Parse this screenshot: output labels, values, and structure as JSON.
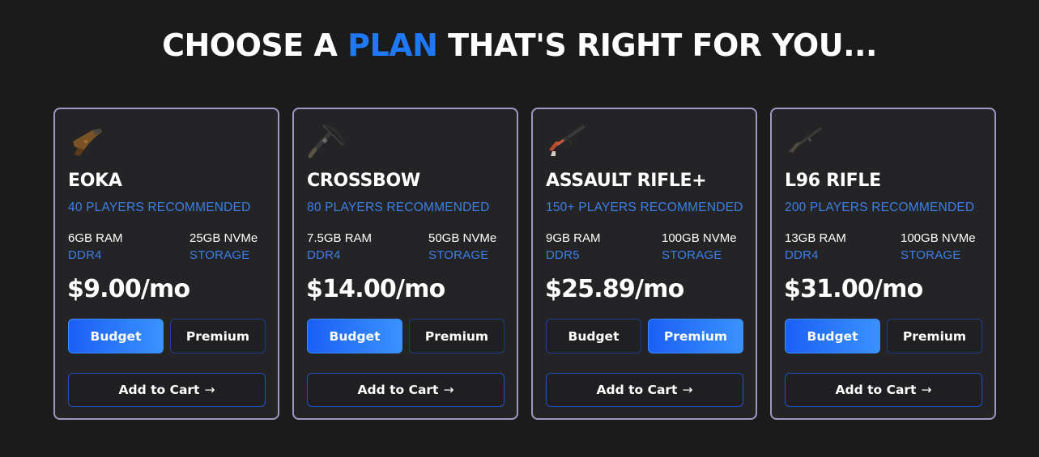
{
  "heading": {
    "prefix": "CHOOSE A ",
    "accent": "PLAN",
    "suffix": " THAT'S RIGHT FOR YOU..."
  },
  "colors": {
    "accent": "#1f78f5",
    "card_border": "#9b98c4",
    "card_bg": "#242426",
    "page_bg": "#1b1b1c",
    "subtext_blue": "#3d7fe6"
  },
  "plans": [
    {
      "name": "EOKA",
      "icon": "pistol-icon",
      "players": "40 PLAYERS RECOMMENDED",
      "ram": "6GB RAM",
      "ram_type": "DDR4",
      "storage": "25GB NVMe",
      "storage_label": "STORAGE",
      "price": "$9.00/mo",
      "budget_label": "Budget",
      "premium_label": "Premium",
      "selected": "Budget",
      "cart_label": "Add to Cart",
      "cart_arrow": "→"
    },
    {
      "name": "CROSSBOW",
      "icon": "crossbow-icon",
      "players": "80 PLAYERS RECOMMENDED",
      "ram": "7.5GB RAM",
      "ram_type": "DDR4",
      "storage": "50GB NVMe",
      "storage_label": "STORAGE",
      "price": "$14.00/mo",
      "budget_label": "Budget",
      "premium_label": "Premium",
      "selected": "Budget",
      "cart_label": "Add to Cart",
      "cart_arrow": "→"
    },
    {
      "name": "ASSAULT RIFLE+",
      "icon": "assault-rifle-icon",
      "players": "150+ PLAYERS RECOMMENDED",
      "ram": "9GB RAM",
      "ram_type": "DDR5",
      "storage": "100GB NVMe",
      "storage_label": "STORAGE",
      "price": "$25.89/mo",
      "budget_label": "Budget",
      "premium_label": "Premium",
      "selected": "Premium",
      "cart_label": "Add to Cart",
      "cart_arrow": "→"
    },
    {
      "name": "L96 RIFLE",
      "icon": "sniper-rifle-icon",
      "players": "200 PLAYERS RECOMMENDED",
      "ram": "13GB RAM",
      "ram_type": "DDR4",
      "storage": "100GB NVMe",
      "storage_label": "STORAGE",
      "price": "$31.00/mo",
      "budget_label": "Budget",
      "premium_label": "Premium",
      "selected": "Budget",
      "cart_label": "Add to Cart",
      "cart_arrow": "→"
    }
  ]
}
